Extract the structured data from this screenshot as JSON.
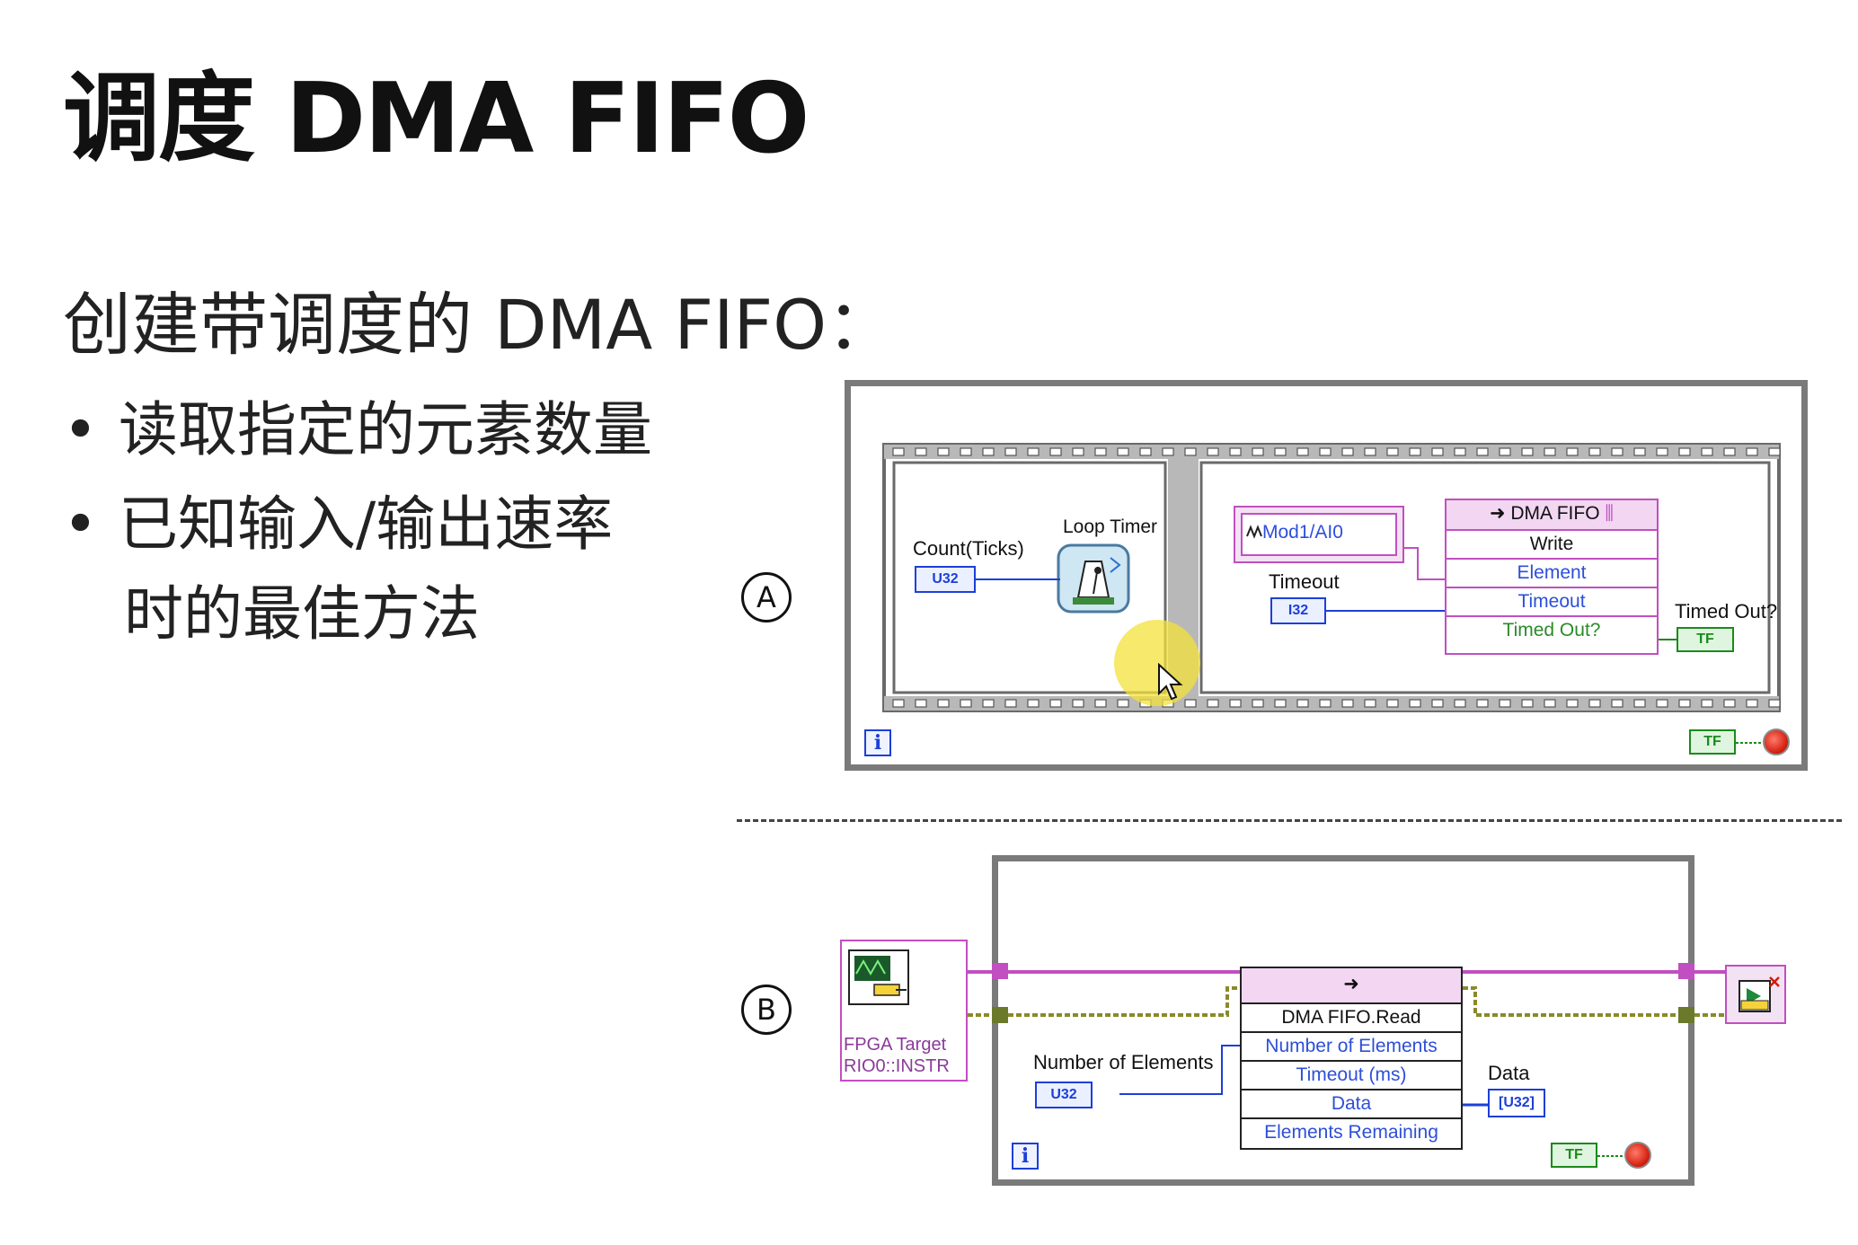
{
  "slide": {
    "title": "调度 DMA FIFO",
    "subtitle": "创建带调度的 DMA FIFO：",
    "bullets": [
      "读取指定的元素数量",
      "已知输入/输出速率"
    ],
    "bullet_continuation": "时的最佳方法",
    "bullet_glyph": "•"
  },
  "diagram_a": {
    "marker": "A",
    "count_label": "Count(Ticks)",
    "count_const": "U32",
    "loop_timer_label": "Loop Timer",
    "io_node_label": "Mod1/AI0",
    "timeout_label": "Timeout",
    "timeout_const": "I32",
    "fifo_header": "DMA FIFO",
    "fifo_rows": [
      "Write",
      "Element",
      "Timeout",
      "Timed Out?"
    ],
    "timed_out_label": "Timed Out?",
    "tf_indicator": "TF",
    "iteration_label": "i",
    "stop_tf": "TF"
  },
  "diagram_b": {
    "marker": "B",
    "fpga_target_label": "FPGA Target",
    "fpga_resource": "RIO0::INSTR",
    "num_elements_label": "Number of Elements",
    "num_elements_const": "U32",
    "fifo_rows": [
      "DMA FIFO.Read",
      "Number of Elements",
      "Timeout (ms)",
      "Data",
      "Elements Remaining"
    ],
    "data_label": "Data",
    "data_indicator": "[U32]",
    "iteration_label": "i",
    "stop_tf": "TF"
  },
  "colors": {
    "frame": "#7a7a7a",
    "wire_blue": "#1d3fd8",
    "wire_pink": "#c14fc1",
    "wire_olive": "#8a8a2a",
    "bool_green": "#1c8a1c",
    "cursor_highlight": "#f3e23a"
  },
  "icons": [
    "loop-timer-icon",
    "fpga-target-icon",
    "close-reference-icon",
    "stop-button-icon",
    "mouse-cursor-icon"
  ]
}
